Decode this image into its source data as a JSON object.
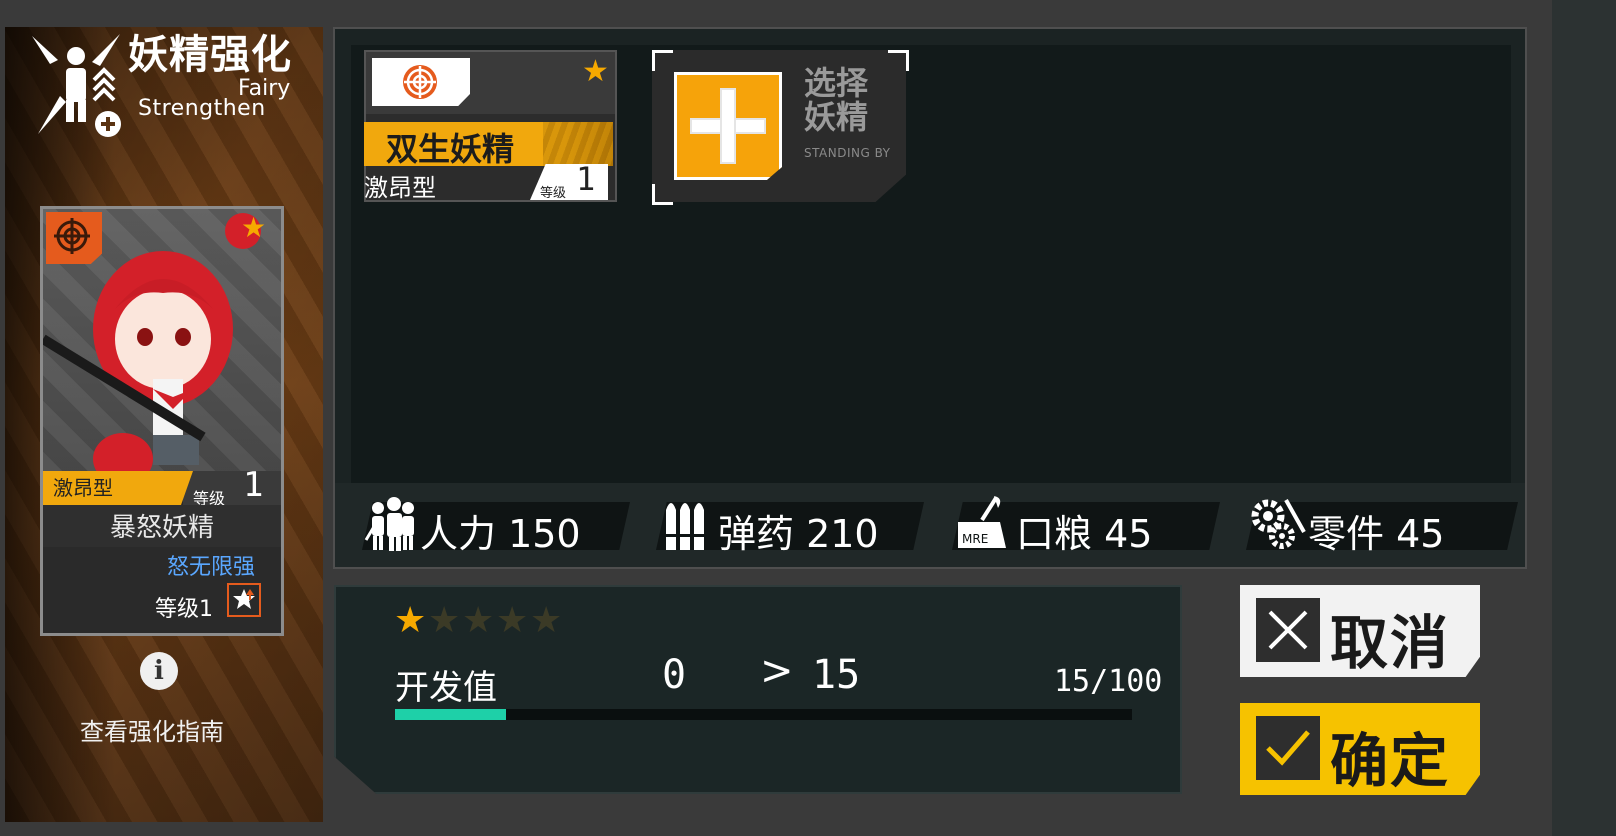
{
  "header": {
    "title_cn": "妖精强化",
    "title_en_line1": "Fairy",
    "title_en_line2": "Strengthen"
  },
  "fairy_card": {
    "type": "激昂型",
    "level_label": "等级",
    "level_value": "1",
    "name": "暴怒妖精",
    "skill_name": "怒无限强",
    "skill_level": "等级1",
    "rarity_icon": "star-icon"
  },
  "guide": {
    "icon": "info-icon",
    "label": "查看强化指南"
  },
  "material_fairy": {
    "name": "双生妖精",
    "type": "激昂型",
    "level_label": "等级",
    "level_value": "1"
  },
  "add_slot": {
    "label": "选择\n妖精",
    "sub": "STANDING BY"
  },
  "resources": [
    {
      "icon": "manpower-icon",
      "text": "人力 150"
    },
    {
      "icon": "ammo-icon",
      "text": "弹药 210"
    },
    {
      "icon": "rations-icon",
      "text": "口粮 45"
    },
    {
      "icon": "parts-icon",
      "text": "零件 45"
    }
  ],
  "progress": {
    "stars_filled": 1,
    "stars_total": 5,
    "label": "开发值",
    "from": "0",
    "arrow": ">",
    "to": "15",
    "ratio": "15/100",
    "fraction": 0.15
  },
  "buttons": {
    "cancel": "取消",
    "confirm": "确定"
  },
  "colors": {
    "accent_orange": "#f6a30a",
    "progress_fill": "#1ed0a8",
    "skill_blue": "#5aa7ff",
    "type_badge": "#e55b1d",
    "confirm_yellow": "#f6c200"
  }
}
